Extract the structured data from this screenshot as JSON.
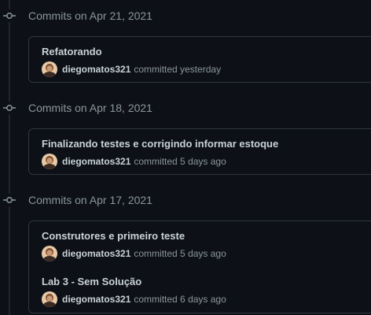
{
  "groups": [
    {
      "title": "Commits on Apr 21, 2021",
      "commits": [
        {
          "title": "Refatorando",
          "author": "diegomatos321",
          "time": "committed yesterday"
        }
      ]
    },
    {
      "title": "Commits on Apr 18, 2021",
      "commits": [
        {
          "title": "Finalizando testes e corrigindo informar estoque",
          "author": "diegomatos321",
          "time": "committed 5 days ago"
        }
      ]
    },
    {
      "title": "Commits on Apr 17, 2021",
      "commits": [
        {
          "title": "Construtores e primeiro teste",
          "author": "diegomatos321",
          "time": "committed 5 days ago"
        },
        {
          "title": "Lab 3 - Sem Solução",
          "author": "diegomatos321",
          "time": "committed 6 days ago"
        }
      ]
    }
  ],
  "colors": {
    "background": "#0d1117",
    "border": "#30363d",
    "text_primary": "#c9d1d9",
    "text_muted": "#8b949e"
  },
  "icons": {
    "group_marker": "git-commit-icon",
    "author_avatar": "avatar"
  }
}
